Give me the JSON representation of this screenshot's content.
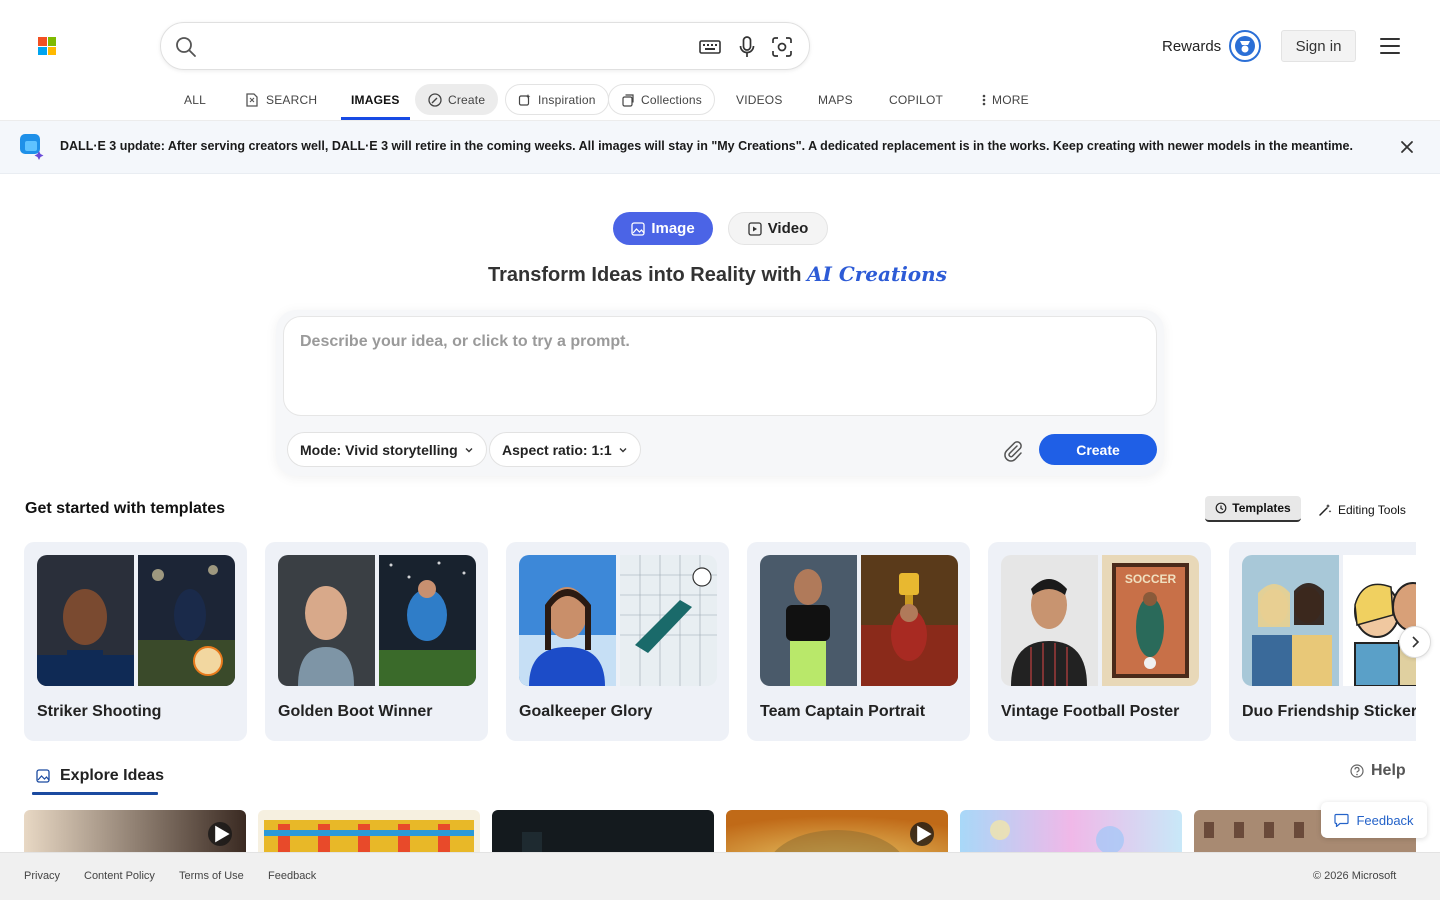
{
  "header": {
    "search_placeholder": "",
    "rewards_label": "Rewards",
    "signin_label": "Sign in"
  },
  "nav": {
    "all": "ALL",
    "search": "SEARCH",
    "images": "IMAGES",
    "create": "Create",
    "inspiration": "Inspiration",
    "collections": "Collections",
    "videos": "VIDEOS",
    "maps": "MAPS",
    "copilot": "COPILOT",
    "more": "MORE"
  },
  "banner": {
    "text": "DALL·E 3 update: After serving creators well, DALL·E 3 will retire in the coming weeks. All images will stay in \"My Creations\". A dedicated replacement is in the works. Keep creating with newer models in the meantime."
  },
  "creator": {
    "toggle_image": "Image",
    "toggle_video": "Video",
    "headline_main": "Transform Ideas into Reality with ",
    "headline_accent": "AI Creations",
    "prompt_placeholder": "Describe your idea, or click to try a prompt.",
    "mode_label": "Mode: Vivid storytelling",
    "aspect_label": "Aspect ratio: 1:1",
    "create_label": "Create"
  },
  "templates": {
    "title": "Get started with templates",
    "tab_templates": "Templates",
    "tab_editing": "Editing Tools",
    "items": [
      {
        "label": "Striker Shooting"
      },
      {
        "label": "Golden Boot Winner"
      },
      {
        "label": "Goalkeeper Glory"
      },
      {
        "label": "Team Captain Portrait"
      },
      {
        "label": "Vintage Football Poster"
      },
      {
        "label": "Duo Friendship Sticker"
      }
    ],
    "poster_text": "SOCCER"
  },
  "explore": {
    "title": "Explore Ideas",
    "help_label": "Help",
    "feedback_label": "Feedback"
  },
  "footer": {
    "links": [
      "Privacy",
      "Content Policy",
      "Terms of Use",
      "Feedback"
    ],
    "copyright": "© 2026 Microsoft"
  },
  "colors": {
    "accent": "#1f5fe6",
    "toggle_active": "#4b64e6",
    "ms_red": "#f25022",
    "ms_green": "#7fba00",
    "ms_blue": "#00a4ef",
    "ms_yellow": "#ffb900"
  }
}
